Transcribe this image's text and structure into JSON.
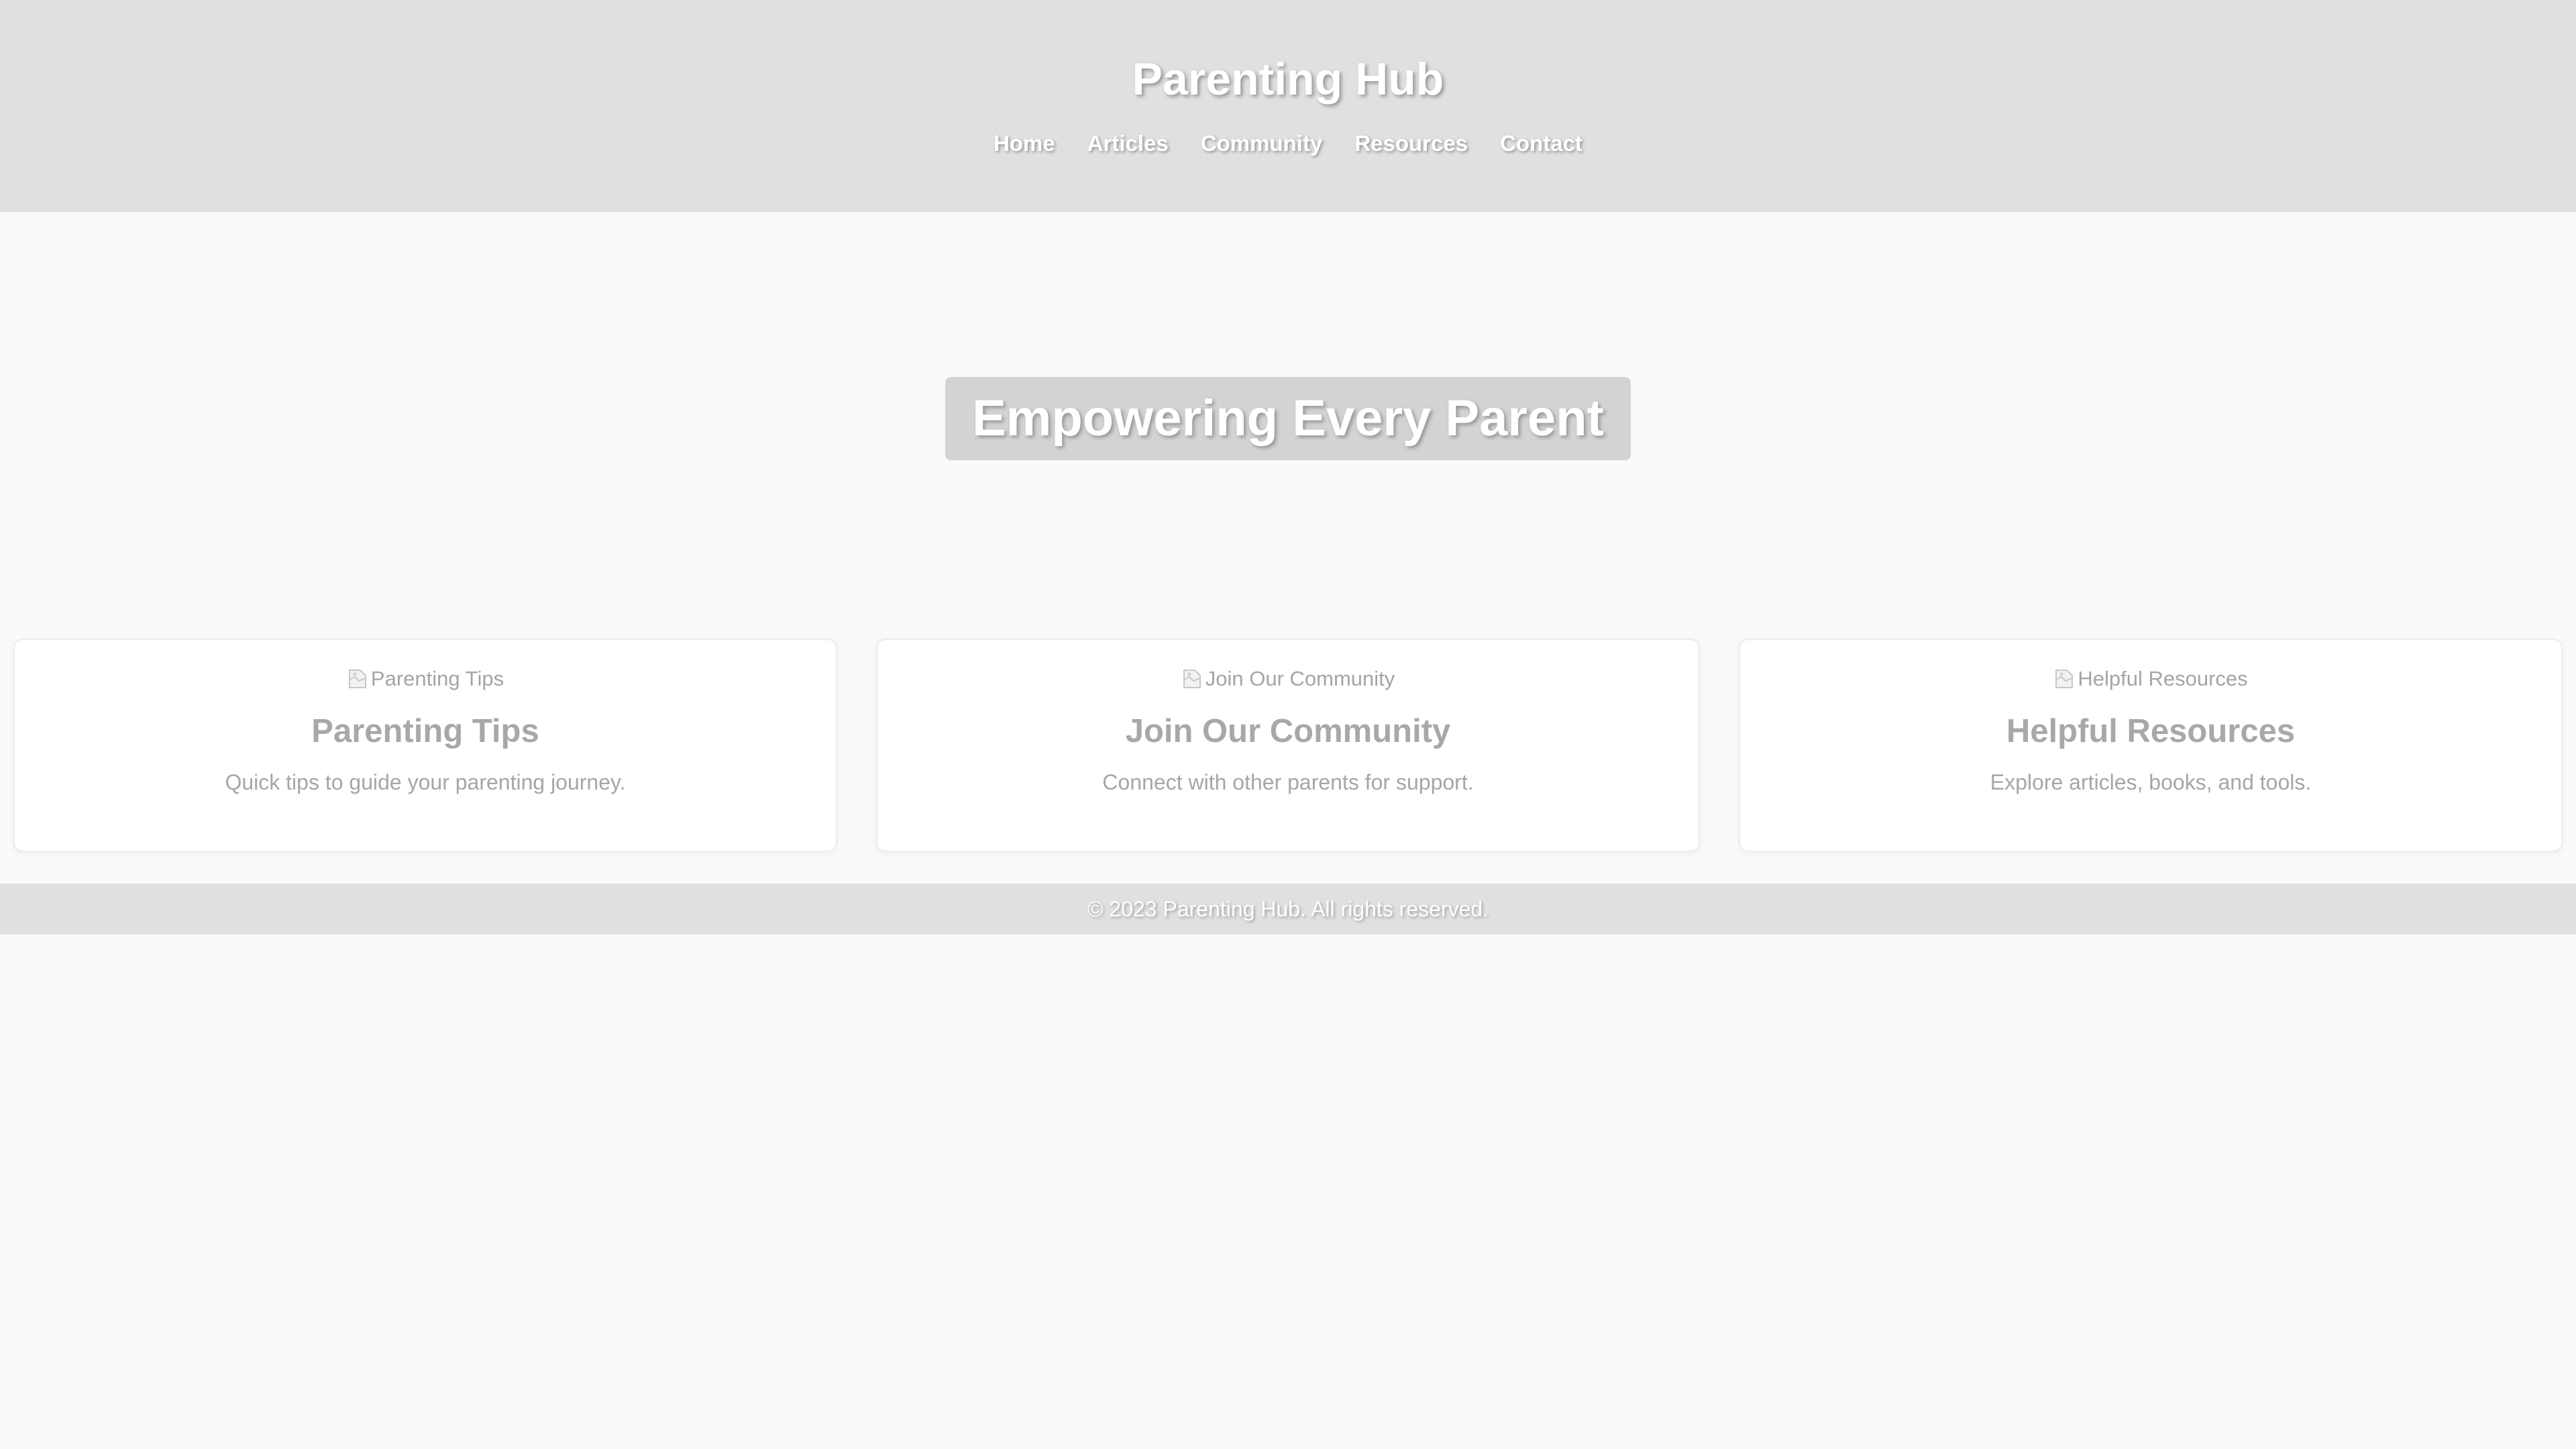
{
  "header": {
    "title": "Parenting Hub",
    "nav": [
      "Home",
      "Articles",
      "Community",
      "Resources",
      "Contact"
    ]
  },
  "hero": {
    "title": "Empowering Every Parent"
  },
  "cards": [
    {
      "image_alt": "Parenting Tips",
      "title": "Parenting Tips",
      "description": "Quick tips to guide your parenting journey."
    },
    {
      "image_alt": "Join Our Community",
      "title": "Join Our Community",
      "description": "Connect with other parents for support."
    },
    {
      "image_alt": "Helpful Resources",
      "title": "Helpful Resources",
      "description": "Explore articles, books, and tools."
    }
  ],
  "footer": {
    "copyright": "© 2023 Parenting Hub. All rights reserved."
  },
  "icons": {
    "card_image": "broken-image-icon"
  },
  "colors": {
    "header_bg": "#e0e0e0",
    "page_bg": "#fafafa",
    "hero_badge_bg": "#d3d3d3",
    "card_bg": "#ffffff",
    "muted_text": "#a8a8a8"
  }
}
